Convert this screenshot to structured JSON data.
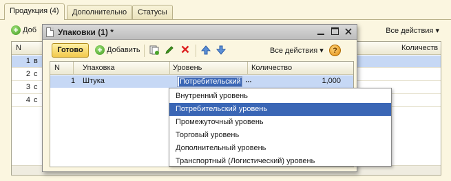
{
  "tabs": [
    {
      "label": "Продукция (4)",
      "active": true
    },
    {
      "label": "Дополнительно",
      "active": false
    },
    {
      "label": "Статусы",
      "active": false
    }
  ],
  "main": {
    "add_label": "Доб",
    "all_actions": "Все действия",
    "columns": {
      "num": "N",
      "col2": "",
      "qty": "Количеств"
    },
    "rows": [
      {
        "num": "1",
        "text": "в"
      },
      {
        "num": "2",
        "text": "с"
      },
      {
        "num": "3",
        "text": "с"
      },
      {
        "num": "4",
        "text": "с"
      }
    ]
  },
  "dialog": {
    "title": "Упаковки (1) *",
    "toolbar": {
      "done": "Готово",
      "add": "Добавить",
      "all_actions": "Все действия",
      "help": "?"
    },
    "columns": {
      "num": "N",
      "pack": "Упаковка",
      "level": "Уровень",
      "qty": "Количество"
    },
    "row": {
      "num": "1",
      "pack": "Штука",
      "level": "Потребительский",
      "qty": "1,000"
    },
    "edit_button": "..."
  },
  "dropdown": {
    "items": [
      "Внутренний уровень",
      "Потребительский уровень",
      "Промежуточный уровень",
      "Торговый уровень",
      "Дополнительный уровень",
      "Транспортный (Логистический) уровень"
    ],
    "selected_index": 1
  },
  "colors": {
    "background": "#fbf6e0",
    "selection_row": "#c6d8f5",
    "selection_item": "#3a66b5",
    "done_button": "#f2c94c"
  }
}
